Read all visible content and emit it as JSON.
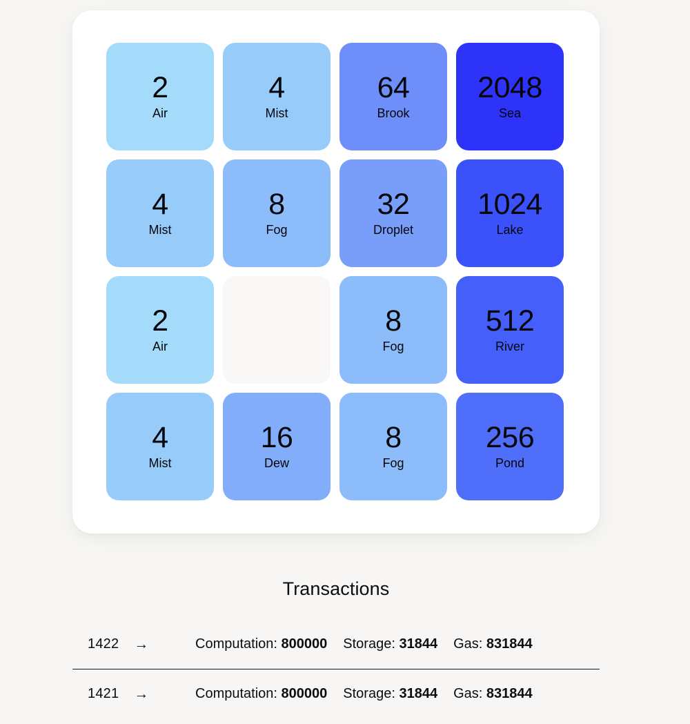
{
  "board": {
    "rows": [
      [
        {
          "value": "2",
          "label": "Air",
          "color": "#a5dbfa"
        },
        {
          "value": "4",
          "label": "Mist",
          "color": "#96cbfa"
        },
        {
          "value": "64",
          "label": "Brook",
          "color": "#6e8ffa"
        },
        {
          "value": "2048",
          "label": "Sea",
          "color": "#2e33fa"
        }
      ],
      [
        {
          "value": "4",
          "label": "Mist",
          "color": "#96cbfa"
        },
        {
          "value": "8",
          "label": "Fog",
          "color": "#8cbcfa"
        },
        {
          "value": "32",
          "label": "Droplet",
          "color": "#789efa"
        },
        {
          "value": "1024",
          "label": "Lake",
          "color": "#3b51fa"
        }
      ],
      [
        {
          "value": "2",
          "label": "Air",
          "color": "#a5dbfa"
        },
        {
          "value": "",
          "label": "",
          "color": "#faf8f7",
          "empty": true
        },
        {
          "value": "8",
          "label": "Fog",
          "color": "#8cbcfa"
        },
        {
          "value": "512",
          "label": "River",
          "color": "#4560fa"
        }
      ],
      [
        {
          "value": "4",
          "label": "Mist",
          "color": "#96cbfa"
        },
        {
          "value": "16",
          "label": "Dew",
          "color": "#82adfa"
        },
        {
          "value": "8",
          "label": "Fog",
          "color": "#8cbcfa"
        },
        {
          "value": "256",
          "label": "Pond",
          "color": "#4f6ffa"
        }
      ]
    ]
  },
  "transactions": {
    "title": "Transactions",
    "arrow_glyph": "→",
    "metric_labels": {
      "computation": "Computation:",
      "storage": "Storage:",
      "gas": "Gas:"
    },
    "rows": [
      {
        "id": "1422",
        "computation": "800000",
        "storage": "31844",
        "gas": "831844"
      },
      {
        "id": "1421",
        "computation": "800000",
        "storage": "31844",
        "gas": "831844"
      }
    ]
  },
  "theme": {
    "page_background": "#f7f6f4",
    "card_background": "#ffffff",
    "empty_tile": "#faf8f7",
    "text": "#0b0c10",
    "divider": "#15161a"
  }
}
